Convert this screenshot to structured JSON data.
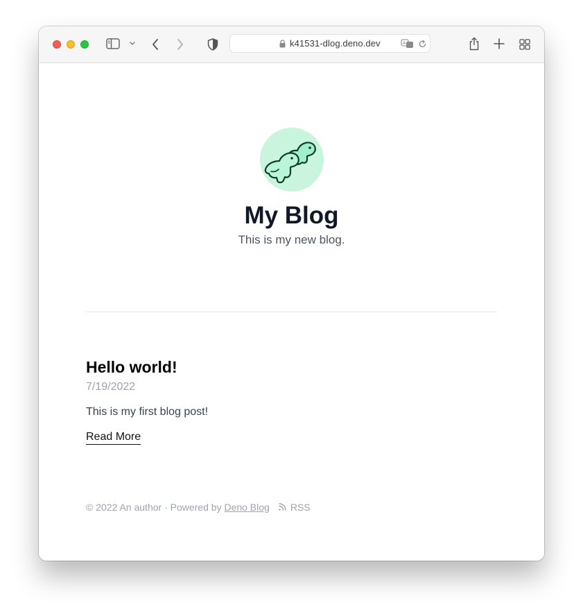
{
  "browser": {
    "url": "k41531-dlog.deno.dev",
    "colors": {
      "close": "#ee5f57",
      "minimize": "#f8bd30",
      "zoom": "#29c740"
    }
  },
  "blog": {
    "title": "My Blog",
    "description": "This is my new blog."
  },
  "posts": [
    {
      "title": "Hello world!",
      "date": "7/19/2022",
      "snippet": "This is my first blog post!",
      "read_more": "Read More"
    }
  ],
  "footer": {
    "copyright": "© 2022 An author · Powered by ",
    "powered_link": "Deno Blog",
    "rss": "RSS"
  }
}
